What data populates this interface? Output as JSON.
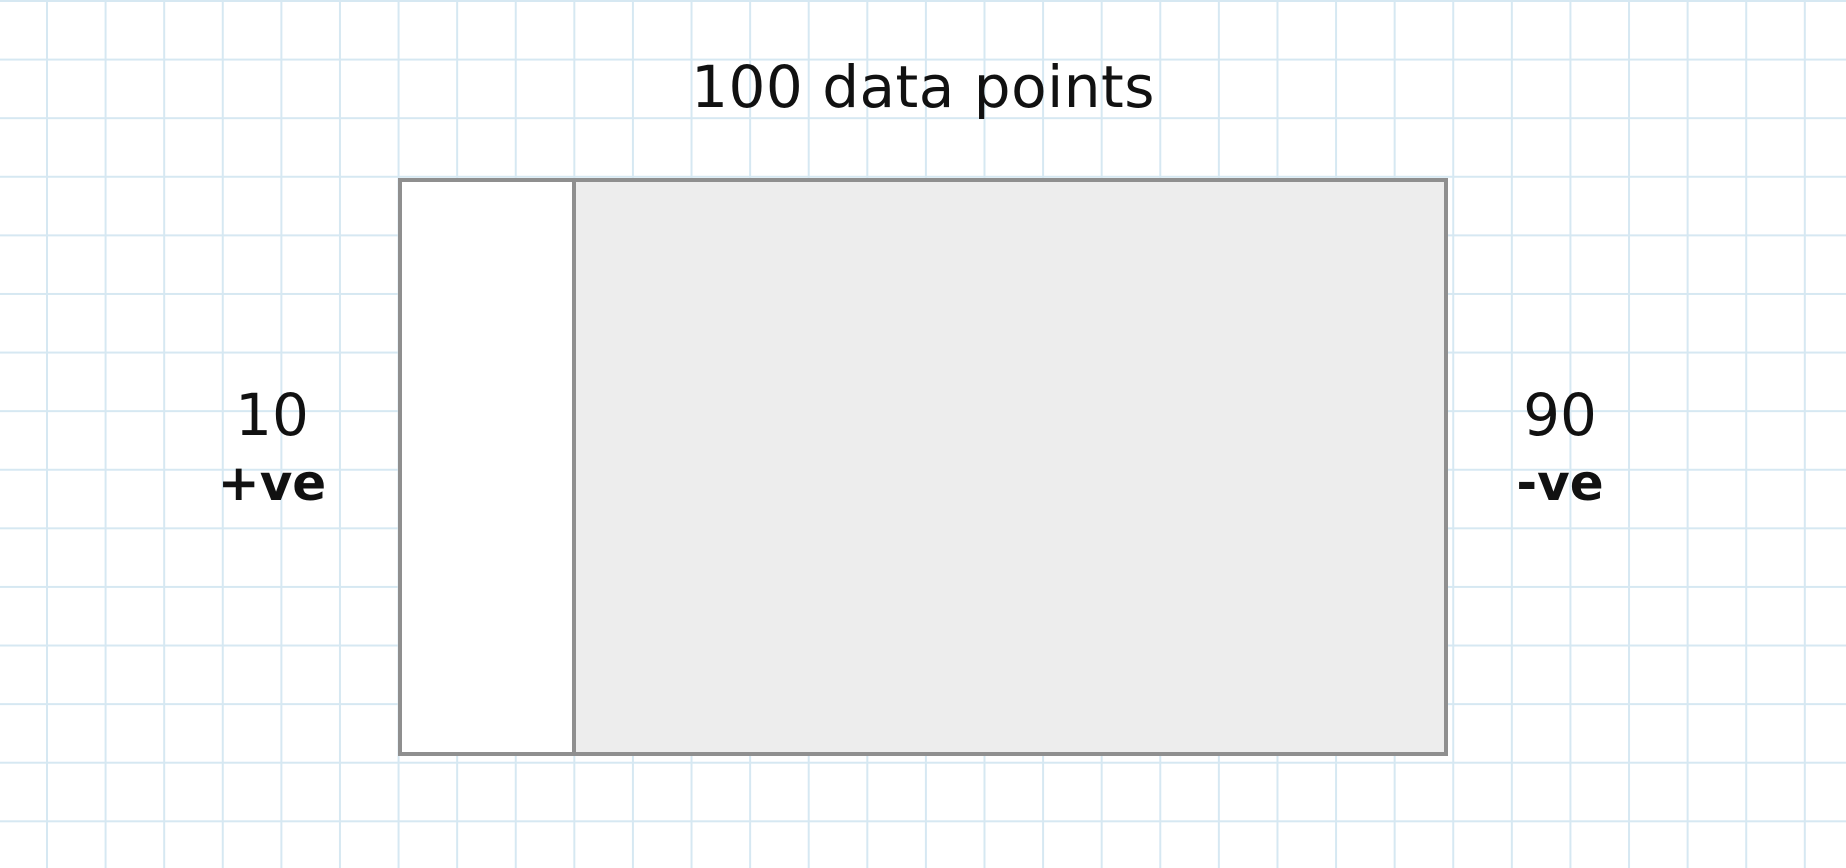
{
  "title": "100 data points",
  "positive": {
    "count": "10",
    "label": "+ve"
  },
  "negative": {
    "count": "90",
    "label": "-ve"
  },
  "colors": {
    "grid": "#d6e8f2",
    "border": "#8f8f8f",
    "positive_fill": "#ffffff",
    "negative_fill": "#ededed"
  }
}
